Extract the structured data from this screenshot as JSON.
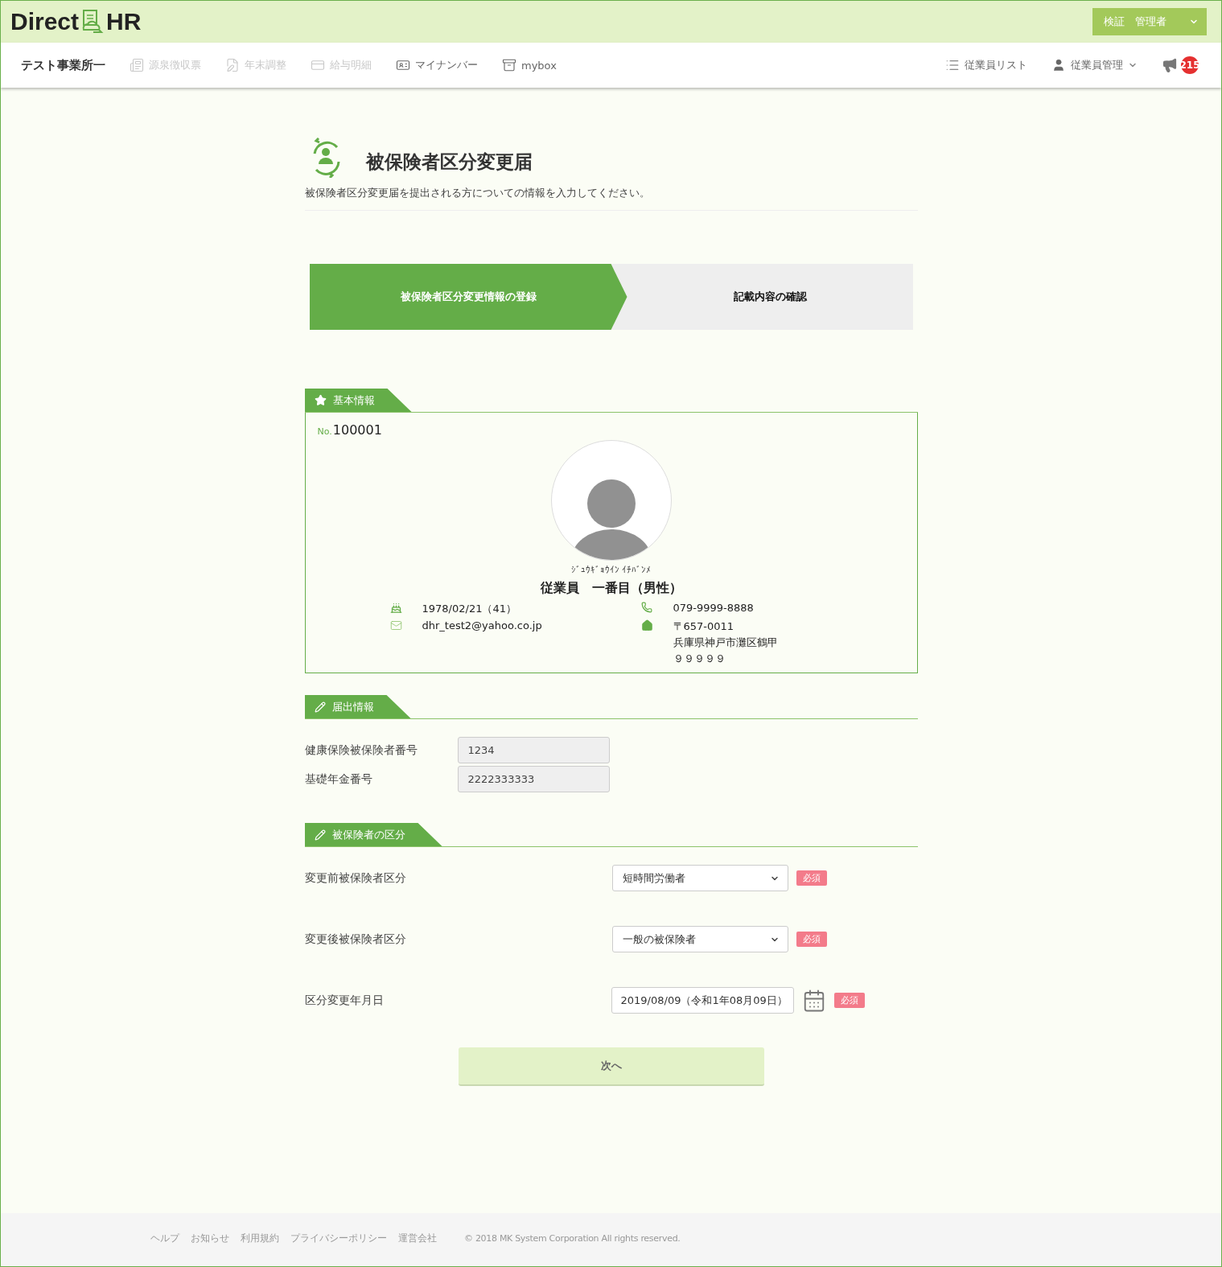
{
  "header": {
    "logo": {
      "left": "Direct",
      "right": "HR"
    },
    "user_menu": "検証　管理者"
  },
  "nav": {
    "office": "テスト事業所一",
    "items": [
      {
        "kind": "withholding",
        "label": "源泉徴収票",
        "disabled": true
      },
      {
        "kind": "adjustment",
        "label": "年末調整",
        "disabled": true
      },
      {
        "kind": "payslip",
        "label": "給与明細",
        "disabled": true
      },
      {
        "kind": "mynumber",
        "label": "マイナンバー",
        "disabled": false
      },
      {
        "kind": "mybox",
        "label": "mybox",
        "disabled": false
      }
    ],
    "right_items": [
      {
        "kind": "list",
        "label": "従業員リスト",
        "dropdown": false
      },
      {
        "kind": "user",
        "label": "従業員管理",
        "dropdown": true
      }
    ],
    "notifications": {
      "count": "215"
    }
  },
  "page": {
    "title": "被保険者区分変更届",
    "description": "被保険者区分変更届を提出される方についての情報を入力してください。"
  },
  "steps": [
    {
      "label": "被保険者区分変更情報の登録",
      "selected": true
    },
    {
      "label": "記載内容の確認",
      "selected": false
    }
  ],
  "basic_info": {
    "heading": {
      "kind": "star",
      "label": "基本情報"
    },
    "number_prefix": "No.",
    "number": "100001",
    "kana": "ｼﾞｭｳｷﾞｮｳｲﾝ ｲﾁﾊﾞﾝﾒ",
    "name": "従業員　一番目（男性）",
    "birthday": "1978/02/21（41）",
    "email": "dhr_test2@yahoo.co.jp",
    "phone": "079-9999-8888",
    "postal": "〒657-0011",
    "address": [
      "兵庫県神戸市灘区鶴甲",
      "９９９９９"
    ]
  },
  "sections": [
    {
      "kind": "pencil",
      "heading": "届出情報",
      "fields": [
        {
          "kind": "readonly",
          "label": "健康保険被保険者番号",
          "value": "1234"
        },
        {
          "kind": "readonly",
          "label": "基礎年金番号",
          "value": "2222333333"
        }
      ]
    },
    {
      "kind": "pencil",
      "heading": "被保険者の区分",
      "fields": [
        {
          "kind": "select",
          "label": "変更前被保険者区分",
          "value": "短時間労働者",
          "required": "必須"
        },
        {
          "kind": "select",
          "label": "変更後被保険者区分",
          "value": "一般の被保険者",
          "required": "必須"
        },
        {
          "kind": "date",
          "label": "区分変更年月日",
          "value": "2019/08/09（令和1年08月09日）",
          "required": "必須"
        }
      ]
    }
  ],
  "next_button": "次へ",
  "footer": {
    "links": [
      "ヘルプ",
      "お知らせ",
      "利用規約",
      "プライバシーポリシー",
      "運営会社"
    ],
    "copyright": "© 2018 MK System Corporation All rights reserved."
  }
}
